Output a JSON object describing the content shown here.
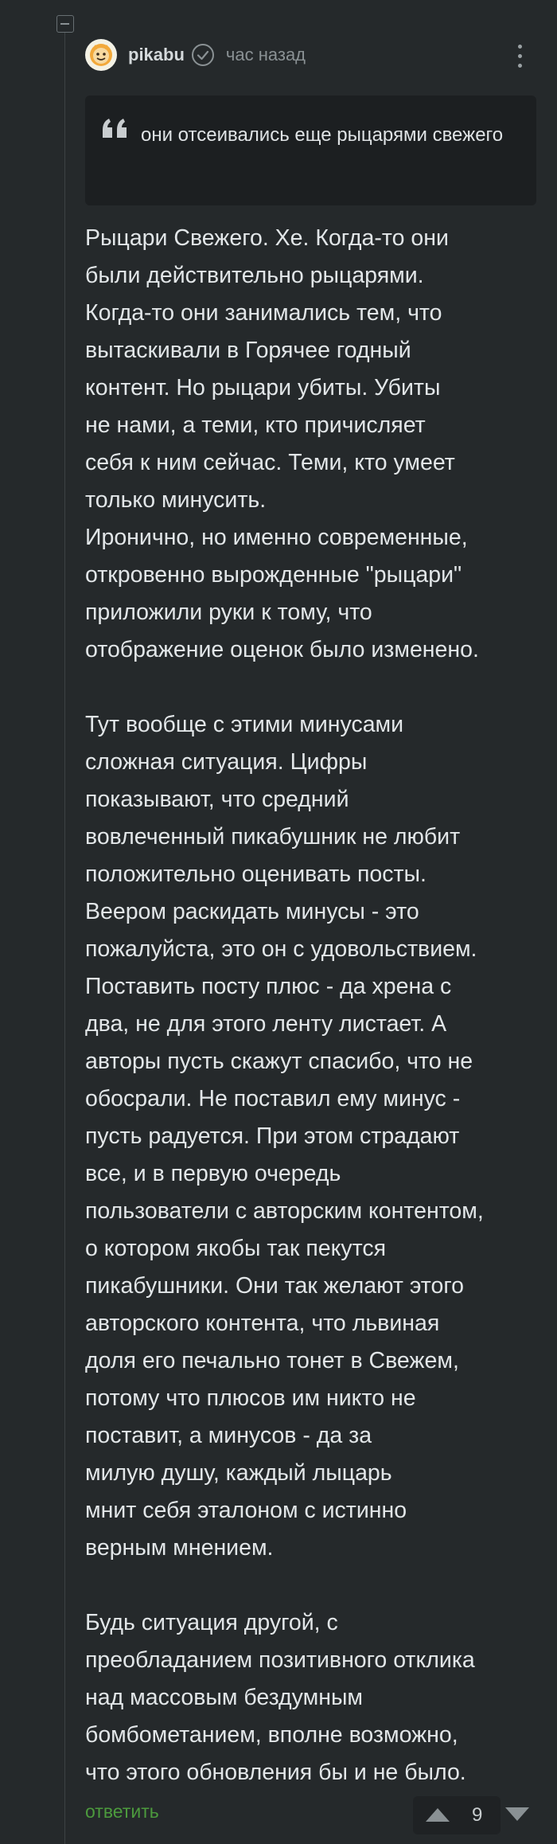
{
  "comment": {
    "author": "pikabu",
    "time": "час назад",
    "quote": {
      "lines": [
        "они отсеивались еще",
        "рыцарями свежего"
      ]
    },
    "paragraphs": [
      [
        "Рыцари Свежего. Хе. Когда-то они",
        "были действительно рыцарями.",
        "Когда-то они занимались тем, что",
        "вытаскивали в Горячее годный",
        "контент. Но рыцари убиты. Убиты",
        "не нами, а теми, кто причисляет",
        "себя к ним сейчас. Теми, кто умеет",
        "только минусить.",
        "Иронично, но именно современные,",
        "откровенно вырожденные \"рыцари\"",
        "приложили руки к тому, что",
        "отображение оценок было изменено."
      ],
      [
        "Тут вообще с этими минусами",
        "сложная ситуация. Цифры",
        "показывают, что средний",
        "вовлеченный пикабушник не любит",
        "положительно оценивать посты.",
        "Веером раскидать минусы - это",
        "пожалуйста, это он с удовольствием.",
        "Поставить посту плюс - да хрена с",
        "два, не для этого ленту листает. А",
        "авторы пусть скажут спасибо, что не",
        "обосрали. Не поставил ему минус -",
        "пусть радуется. При этом страдают",
        "все, и в первую очередь",
        "пользователи с авторским контентом,",
        "о котором якобы так пекутся",
        "пикабушники. Они так желают этого",
        "авторского контента, что львиная",
        "доля его печально тонет в Свежем,",
        "потому что плюсов им никто не",
        "поставит, а минусов - да за",
        "милую душу, каждый лыцарь",
        "мнит себя эталоном с истинно",
        "верным мнением."
      ],
      [
        "Будь ситуация другой, с",
        "преобладанием позитивного отклика",
        "над массовым бездумным",
        "бомбометанием, вполне возможно,",
        "что этого обновления бы и не было."
      ]
    ],
    "reply_label": "ответить",
    "score": "9"
  },
  "icons": {
    "collapse": "minus-square-icon",
    "verified": "check-circle-icon",
    "more": "more-vertical-icon",
    "quote": "quote-icon",
    "upvote": "arrow-up-icon",
    "downvote": "arrow-down-icon"
  },
  "colors": {
    "background": "#25292b",
    "quote_background": "#1c1f21",
    "text": "#e2e6e8",
    "muted": "#8a9194",
    "reply": "#4c9a3d"
  }
}
